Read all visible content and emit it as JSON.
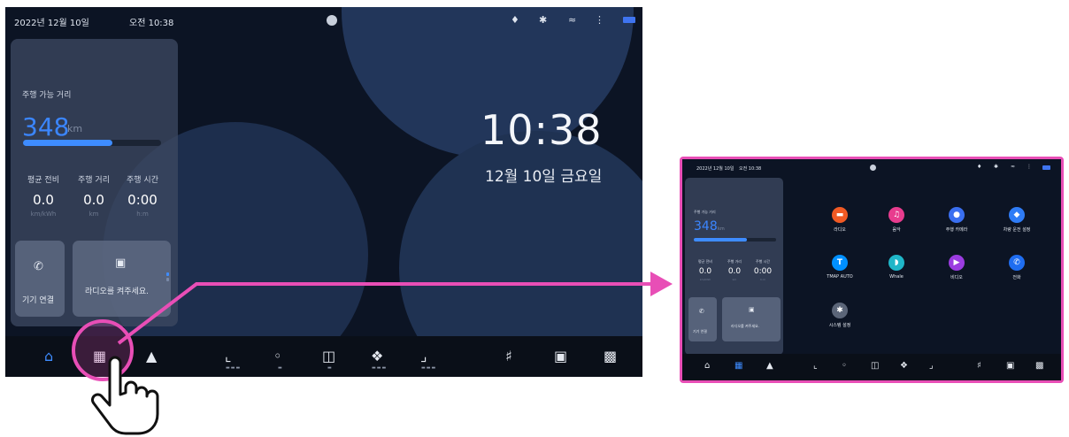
{
  "status_bar": {
    "date": "2022년 12월 10일",
    "time": "오전 10:38",
    "icons": [
      "user-icon",
      "bell-icon",
      "bluetooth-icon",
      "wifi-icon",
      "signal-icon",
      "battery-icon"
    ]
  },
  "trip": {
    "range_label": "주행 가능 거리",
    "range_value": "348",
    "range_unit": "km",
    "range_fill_fraction": 0.65,
    "stats": [
      {
        "label": "평균 전비",
        "value": "0.0",
        "unit": "km/kWh"
      },
      {
        "label": "주행 거리",
        "value": "0.0",
        "unit": "km"
      },
      {
        "label": "주행 시간",
        "value": "0:00",
        "unit": "h:m"
      }
    ]
  },
  "widgets": {
    "phone_label": "기기 연결",
    "radio_label": "라디오를 켜주세요."
  },
  "clock": {
    "time": "10:38",
    "date": "12월 10일 금요일"
  },
  "dock": {
    "icons": [
      "home-icon",
      "apps-grid-icon",
      "navigation-icon",
      "seat-heat-icon",
      "steering-heat-icon",
      "cup-heat-icon",
      "seat-vent-icon",
      "seat-adjust-icon",
      "volume-icon",
      "camera-icon",
      "car-icon"
    ]
  },
  "apps_screen": {
    "status_date": "2022년 12월 10일",
    "status_time": "오전 10:38",
    "range_label": "주행 가능 거리",
    "range_value": "348",
    "range_unit": "km",
    "stats": [
      {
        "label": "평균 전비",
        "value": "0.0",
        "unit": "km/kWh"
      },
      {
        "label": "주행 거리",
        "value": "0.0",
        "unit": "km"
      },
      {
        "label": "주행 시간",
        "value": "0:00",
        "unit": "h:m"
      }
    ],
    "phone_label": "기기 연결",
    "radio_label": "라디오를 켜주세요.",
    "apps": [
      {
        "name": "라디오",
        "color": "#f15a24",
        "glyph": "▭"
      },
      {
        "name": "음악",
        "color": "#e83c8e",
        "glyph": "♫"
      },
      {
        "name": "주행 카메라",
        "color": "#3a6ff0",
        "glyph": "●"
      },
      {
        "name": "차량 운전 설정",
        "color": "#2f7cf6",
        "glyph": "◆"
      },
      {
        "name": "TMAP AUTO",
        "color": "#0090ff",
        "glyph": "T"
      },
      {
        "name": "Whale",
        "color": "#1fb6c8",
        "glyph": "◗"
      },
      {
        "name": "비디오",
        "color": "#9b3ce0",
        "glyph": "▶"
      },
      {
        "name": "전화",
        "color": "#1f6df0",
        "glyph": "✆"
      },
      {
        "name": "시스템 설정",
        "color": "#5b6578",
        "glyph": "✱"
      }
    ]
  },
  "colors": {
    "accent": "#3e8cff",
    "highlight": "#e84eb6",
    "screen_bg": "#0c1424"
  }
}
